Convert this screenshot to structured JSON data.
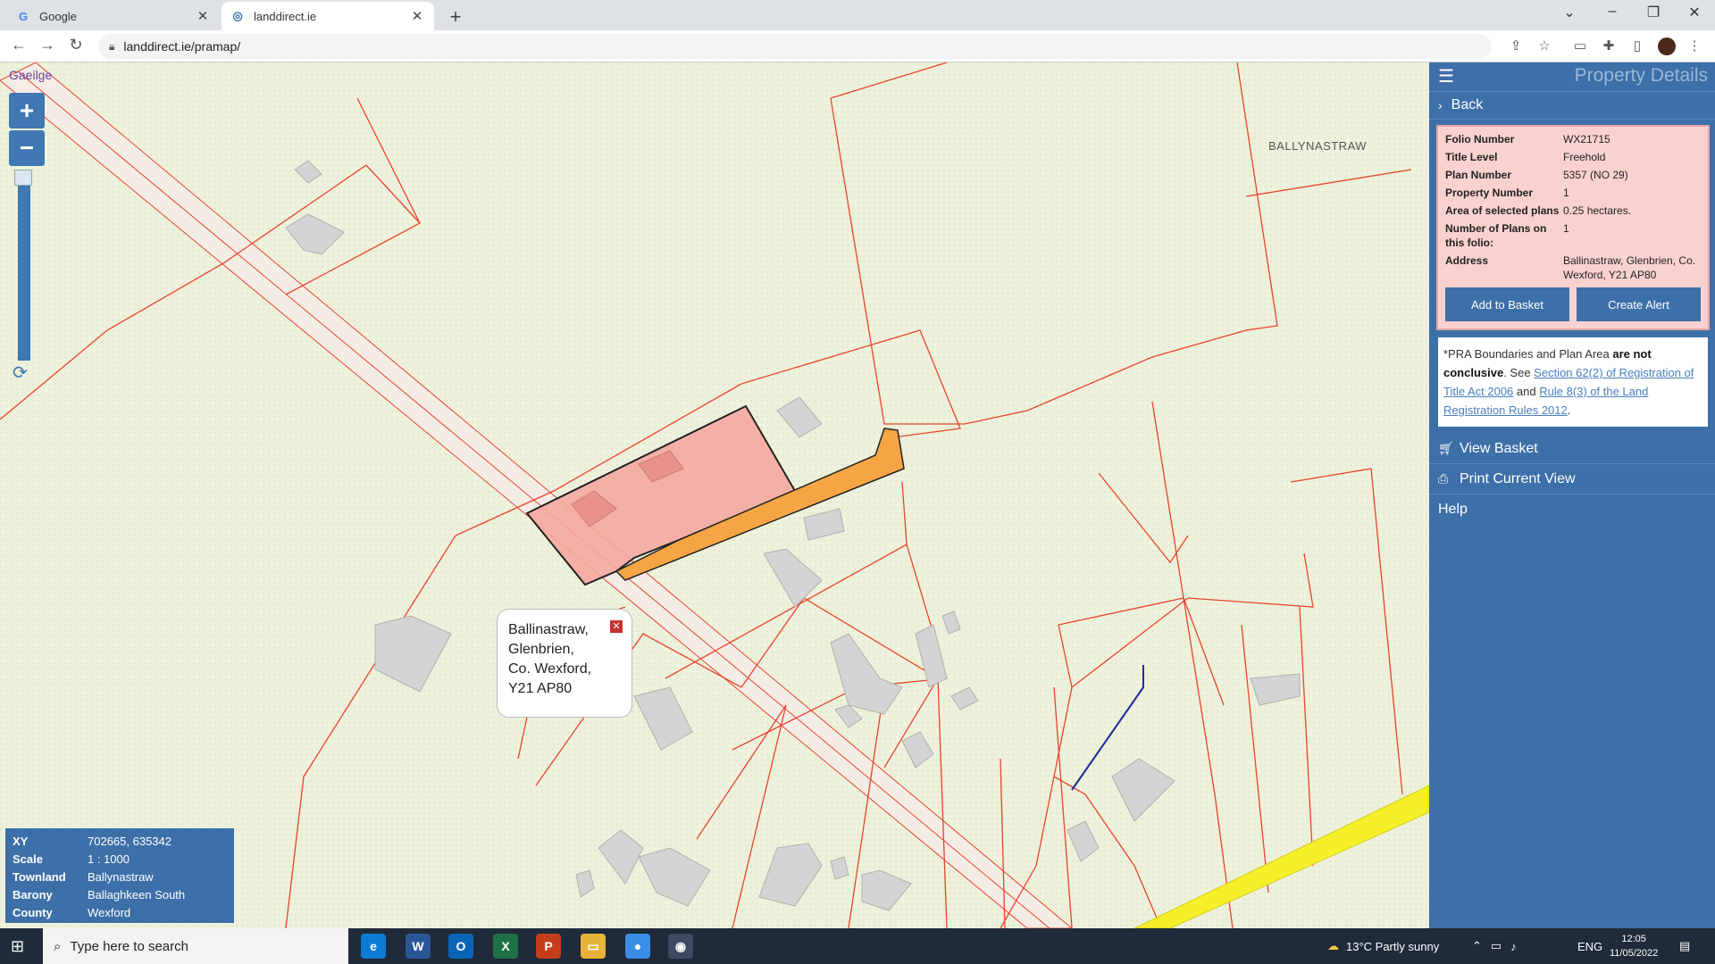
{
  "browser": {
    "tabs": [
      {
        "title": "Google",
        "favicon": "G"
      },
      {
        "title": "landdirect.ie",
        "favicon": "globe-icon"
      }
    ],
    "url": "landdirect.ie/pramap/"
  },
  "map": {
    "language_link": "Gaeilge",
    "zoom_in": "+",
    "zoom_out": "−",
    "townland_label": "BALLYNASTRAW",
    "callout": {
      "lines": [
        "Ballinastraw,",
        "Glenbrien,",
        "Co. Wexford,",
        "Y21 AP80"
      ]
    },
    "info": {
      "rows": [
        {
          "key": "XY",
          "value": "702665, 635342"
        },
        {
          "key": "Scale",
          "value": "1 : 1000"
        },
        {
          "key": "Townland",
          "value": "Ballynastraw"
        },
        {
          "key": "Barony",
          "value": "Ballaghkeen South"
        },
        {
          "key": "County",
          "value": "Wexford"
        }
      ]
    }
  },
  "panel": {
    "title": "Property Details",
    "back_label": "Back",
    "details": [
      {
        "key": "Folio Number",
        "value": "WX21715"
      },
      {
        "key": "Title Level",
        "value": "Freehold"
      },
      {
        "key": "Plan Number",
        "value": "5357 (NO 29)"
      },
      {
        "key": "Property Number",
        "value": "1"
      },
      {
        "key": "Area of selected plans",
        "value": "0.25 hectares."
      },
      {
        "key": "Number of Plans on this folio:",
        "value": "1"
      },
      {
        "key": "Address",
        "value": "Ballinastraw, Glenbrien, Co. Wexford, Y21 AP80"
      }
    ],
    "add_basket": "Add to Basket",
    "create_alert": "Create Alert",
    "notice": {
      "part1": "*PRA Boundaries and Plan Area ",
      "bold": "are not conclusive",
      "part2": ". See ",
      "link1": "Section 62(2) of Registration of Title Act 2006",
      "part3": " and ",
      "link2": "Rule 8(3) of the Land Registration Rules 2012",
      "part4": "."
    },
    "menu": [
      {
        "label": "View Basket",
        "icon": "cart-icon"
      },
      {
        "label": "Print Current View",
        "icon": "print-icon"
      },
      {
        "label": "Help",
        "icon": ""
      }
    ]
  },
  "taskbar": {
    "search_placeholder": "Type here to search",
    "weather": "13°C  Partly sunny",
    "lang": "ENG",
    "time": "12:05",
    "date": "11/05/2022"
  },
  "colors": {
    "panel": "#3d6fa8",
    "selected_plot": "#f4a9a0",
    "access_lane": "#f6a545",
    "road_yellow": "#f5f02a",
    "boundary": "#e8432c"
  }
}
